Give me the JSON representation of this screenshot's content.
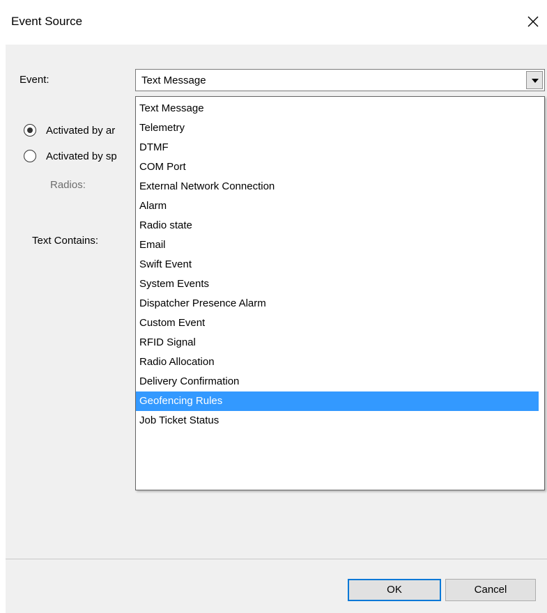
{
  "window": {
    "title": "Event Source"
  },
  "event": {
    "label": "Event:",
    "selected": "Text Message",
    "options": [
      "Text Message",
      "Telemetry",
      "DTMF",
      "COM Port",
      "External Network Connection",
      "Alarm",
      "Radio state",
      "Email",
      "Swift Event",
      "System Events",
      "Dispatcher Presence Alarm",
      "Custom Event",
      "RFID Signal",
      "Radio Allocation",
      "Delivery Confirmation",
      "Geofencing Rules",
      "Job Ticket Status"
    ],
    "highlighted_option": "Geofencing Rules"
  },
  "activation": {
    "option_any": "Activated by ar",
    "option_specific": "Activated by sp",
    "selected": "option_any"
  },
  "radios": {
    "label": "Radios:"
  },
  "text_contains": {
    "label": "Text Contains:"
  },
  "buttons": {
    "ok": "OK",
    "cancel": "Cancel"
  },
  "colors": {
    "highlight": "#3399ff",
    "default_button_border": "#0078d7",
    "dialog_background": "#f0f0f0"
  },
  "icons": {
    "close": "close-icon",
    "dropdown_arrow": "chevron-down-icon"
  }
}
